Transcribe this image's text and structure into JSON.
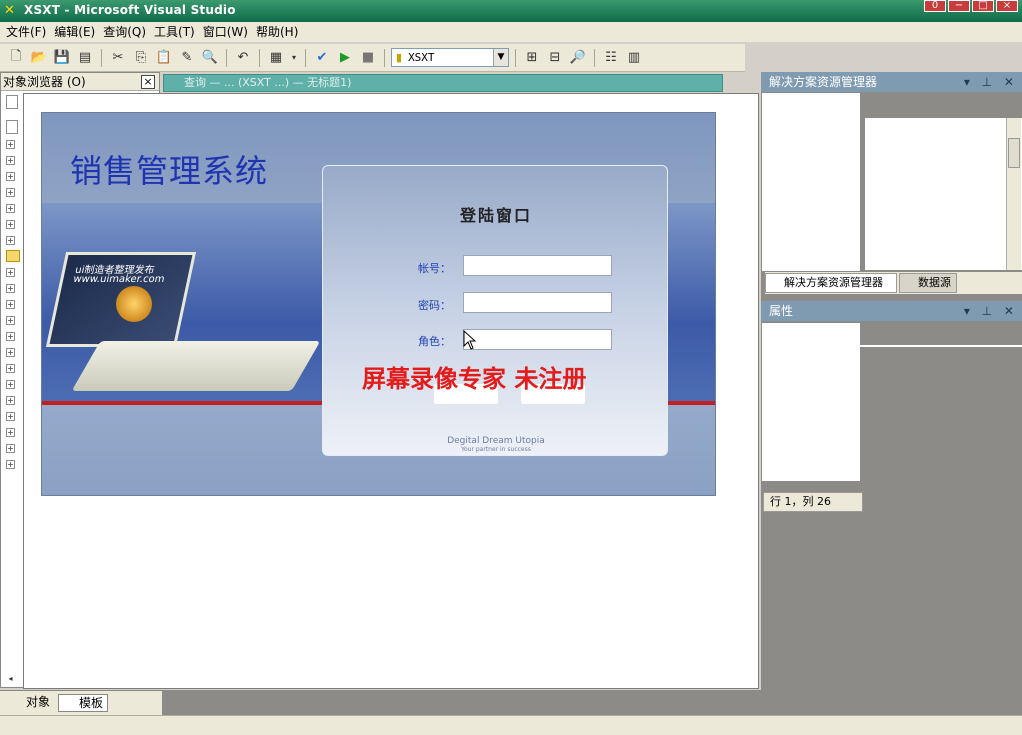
{
  "window": {
    "title": "XSXT - Microsoft Visual Studio",
    "controls": [
      "0",
      "−",
      "□",
      "×"
    ]
  },
  "menu": [
    "文件(F)",
    "编辑(E)",
    "查询(Q)",
    "工具(T)",
    "窗口(W)",
    "帮助(H)"
  ],
  "toolbar": {
    "database_combo": "XSXT"
  },
  "object_browser": {
    "title": "对象浏览器 (O)",
    "close": "×"
  },
  "document_tab": {
    "title": "查询 — ... (XSXT ...) — 无标题1)"
  },
  "app": {
    "system_name": "销售管理系统",
    "login_title": "登陆窗口",
    "fields": {
      "account_label": "帐号：",
      "password_label": "密码：",
      "role_label": "角色："
    },
    "watermark": "屏幕录像专家  未注册",
    "laptop_text_1": "ui制造者整理发布",
    "laptop_text_2": "www.uimaker.com",
    "footer_brand": "Degital Dream Utopia",
    "footer_tagline": "Your partner in success"
  },
  "solution_explorer": {
    "title": "解决方案资源管理器",
    "tabs": [
      "解决方案资源管理器",
      "数据源"
    ]
  },
  "properties": {
    "title": "属性",
    "status": "行 1，列 26"
  },
  "bottom_tabs": [
    "对象",
    "模板"
  ],
  "colors": {
    "title_bar": "#0e6b4a",
    "accent_blue": "#1f34b0",
    "watermark_red": "#e41b1b",
    "pane_header": "#7f9bb2"
  }
}
